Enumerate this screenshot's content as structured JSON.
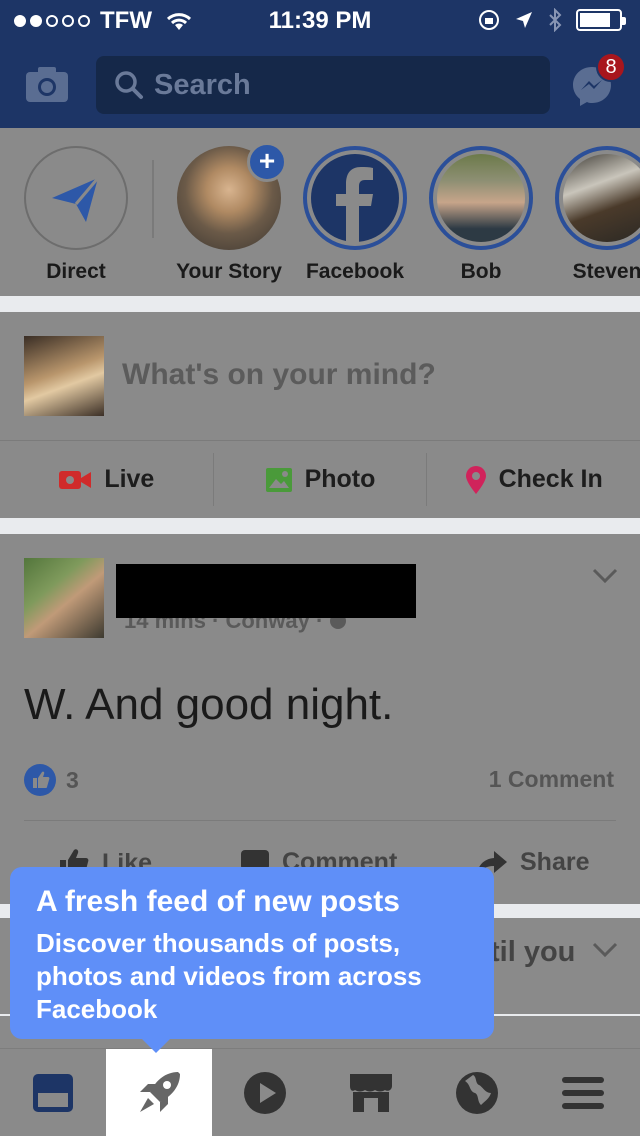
{
  "status_bar": {
    "carrier": "TFW",
    "time": "11:39 PM"
  },
  "nav": {
    "search_placeholder": "Search",
    "messenger_badge": "8"
  },
  "stories": [
    {
      "name": "Direct",
      "icon": "paper-plane-icon"
    },
    {
      "name": "Your Story",
      "icon": "plus-icon"
    },
    {
      "name": "Facebook",
      "icon": "facebook-logo-icon"
    },
    {
      "name": "Bob"
    },
    {
      "name": "Steven"
    }
  ],
  "composer": {
    "prompt": "What's on your mind?",
    "actions": [
      {
        "label": "Live",
        "icon": "live-video-icon",
        "color": "#d02b2b"
      },
      {
        "label": "Photo",
        "icon": "photo-icon",
        "color": "#4a9a3a"
      },
      {
        "label": "Check In",
        "icon": "location-pin-icon",
        "color": "#d0235b"
      }
    ]
  },
  "post": {
    "meta": "14 mins · Conway · ",
    "text": "W. And good night.",
    "like_count": "3",
    "comment_count": "1 Comment",
    "actions": {
      "like": "Like",
      "comment": "Comment",
      "share": "Share"
    }
  },
  "post2": {
    "fragment": "til you"
  },
  "tooltip": {
    "title": "A fresh feed of new posts",
    "body": "Discover thousands of posts, photos and videos from across Facebook"
  },
  "tabbar": {
    "tabs": [
      {
        "icon": "news-feed-icon"
      },
      {
        "icon": "rocket-icon",
        "active": true
      },
      {
        "icon": "play-video-icon"
      },
      {
        "icon": "marketplace-icon"
      },
      {
        "icon": "globe-notifications-icon"
      },
      {
        "icon": "menu-icon"
      }
    ]
  },
  "colors": {
    "brand_blue": "#1d3566",
    "tooltip_blue": "#5f8ff8",
    "badge_red": "#a8161d"
  }
}
